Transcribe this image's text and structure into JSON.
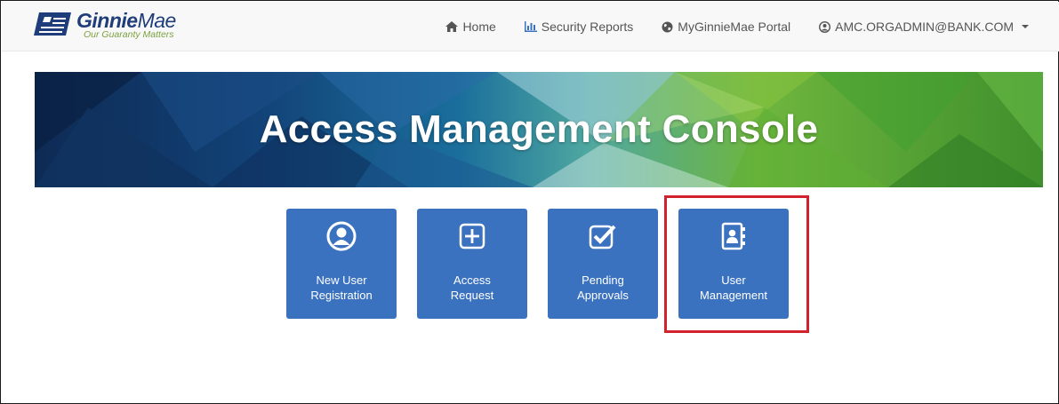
{
  "brand": {
    "name_bold": "Ginnie",
    "name_light": "Mae",
    "tagline": "Our Guaranty Matters",
    "logo_icon": "ginniemae-flag-logo"
  },
  "nav": {
    "items": [
      {
        "label": "Home",
        "icon": "home-icon"
      },
      {
        "label": "Security Reports",
        "icon": "bar-chart-icon"
      },
      {
        "label": "MyGinnieMae Portal",
        "icon": "globe-icon"
      },
      {
        "label": "AMC.ORGADMIN@BANK.COM",
        "icon": "user-circle-icon"
      }
    ]
  },
  "banner": {
    "title": "Access Management Console"
  },
  "tiles": [
    {
      "label_line1": "New User",
      "label_line2": "Registration",
      "icon": "user-circle-icon"
    },
    {
      "label_line1": "Access",
      "label_line2": "Request",
      "icon": "plus-square-icon"
    },
    {
      "label_line1": "Pending",
      "label_line2": "Approvals",
      "icon": "check-square-icon"
    },
    {
      "label_line1": "User",
      "label_line2": "Management",
      "icon": "contact-book-icon"
    }
  ],
  "colors": {
    "tile": "#3a72c0",
    "highlight": "#d2222d",
    "brand_blue": "#1f3d7a",
    "brand_green": "#7ba23f"
  }
}
